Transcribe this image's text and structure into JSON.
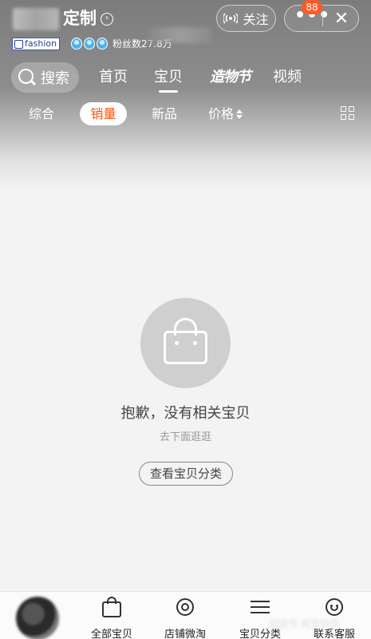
{
  "header": {
    "shop_name_suffix": "定制",
    "tag": "fashion",
    "fans_label": "粉丝数27.8万",
    "follow_label": "关注",
    "more_badge": "88",
    "close_symbol": "✕",
    "more_symbol": "•••"
  },
  "nav": {
    "search_label": "搜索",
    "tabs": [
      {
        "label": "首页",
        "active": false
      },
      {
        "label": "宝贝",
        "active": true
      },
      {
        "label": "造物节",
        "active": false
      },
      {
        "label": "视频",
        "active": false
      }
    ]
  },
  "subnav": {
    "items": [
      {
        "label": "综合",
        "active": false
      },
      {
        "label": "销量",
        "active": true
      },
      {
        "label": "新品",
        "active": false
      },
      {
        "label": "价格",
        "active": false
      }
    ]
  },
  "empty_state": {
    "title": "抱歉，没有相关宝贝",
    "subtitle": "去下面逛逛",
    "button_label": "查看宝贝分类"
  },
  "bottom_bar": {
    "tabs": [
      {
        "label": "全部宝贝",
        "icon": "bag-icon"
      },
      {
        "label": "店铺微淘",
        "icon": "broadcast-icon"
      },
      {
        "label": "宝贝分类",
        "icon": "list-icon"
      },
      {
        "label": "联系客服",
        "icon": "smile-icon"
      }
    ]
  },
  "watermark": "搜狐号 商宝快报",
  "colors": {
    "accent": "#ff5000",
    "badge": "#ff5a23",
    "header_bg": "#8d8d8d"
  }
}
